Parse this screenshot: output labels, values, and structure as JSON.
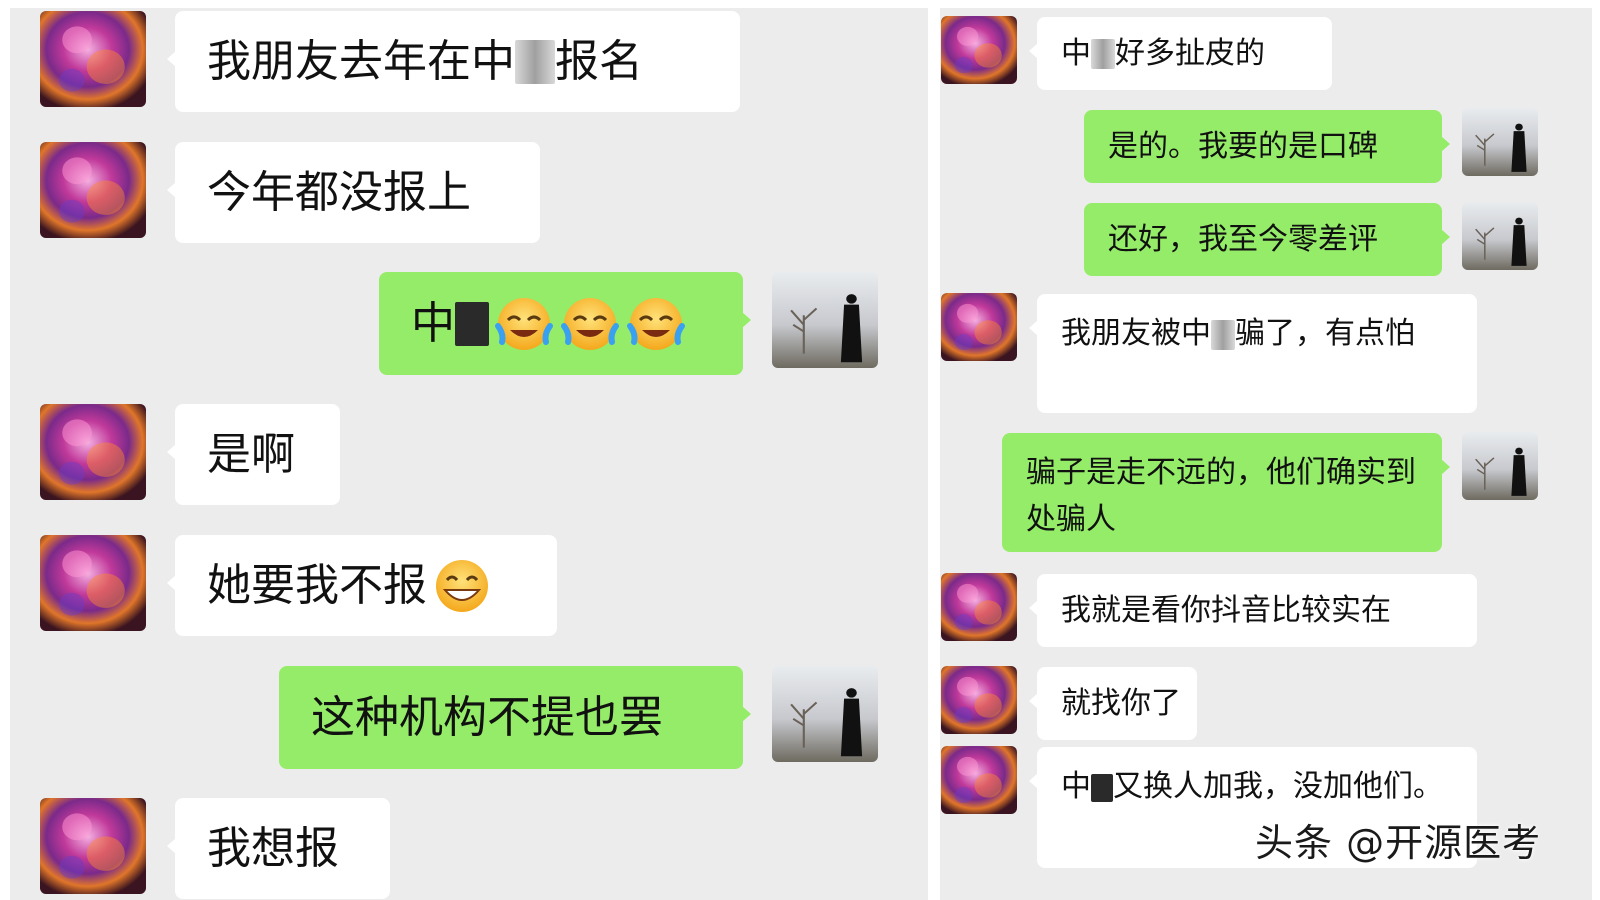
{
  "left_chat": {
    "messages": [
      {
        "side": "received",
        "text_a": "我朋友去年在中",
        "text_b": "报名"
      },
      {
        "side": "received",
        "text": "今年都没报上"
      },
      {
        "side": "sent",
        "text_a": "中",
        "emoji": [
          "face-with-tears-of-joy-icon",
          "face-with-tears-of-joy-icon",
          "face-with-tears-of-joy-icon"
        ]
      },
      {
        "side": "received",
        "text": "是啊"
      },
      {
        "side": "received",
        "text": "她要我不报",
        "emoji": [
          "grinning-face-icon"
        ]
      },
      {
        "side": "sent",
        "text": "这种机构不提也罢"
      },
      {
        "side": "received",
        "text": "我想报"
      }
    ]
  },
  "right_chat": {
    "messages": [
      {
        "side": "received",
        "text_a": "中",
        "text_b": "好多扯皮的"
      },
      {
        "side": "sent",
        "text": "是的。我要的是口碑"
      },
      {
        "side": "sent",
        "text": "还好，我至今零差评"
      },
      {
        "side": "received",
        "text_a": "我朋友被中",
        "text_b": "骗了，有点怕"
      },
      {
        "side": "sent",
        "text": "骗子是走不远的，他们确实到处骗人"
      },
      {
        "side": "received",
        "text": "我就是看你抖音比较实在"
      },
      {
        "side": "received",
        "text": "就找你了"
      },
      {
        "side": "received",
        "text_a": "中",
        "text_b": "又换人加我，没加他们。"
      }
    ]
  },
  "watermark": "头条 @开源医考",
  "colors": {
    "sent_bubble": "#95ec69",
    "received_bubble": "#ffffff",
    "chat_background": "#ececec"
  }
}
